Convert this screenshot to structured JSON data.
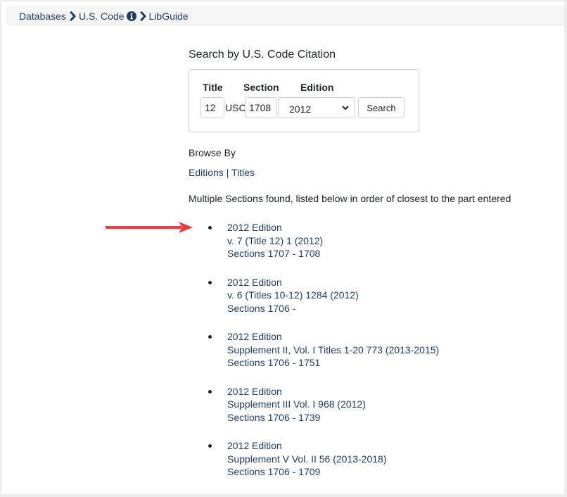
{
  "breadcrumb": {
    "items": [
      {
        "label": "Databases"
      },
      {
        "label": "U.S. Code"
      },
      {
        "label": "LibGuide"
      }
    ],
    "separator_icon": "chevron-right-icon",
    "info_icon": "info-circle-icon"
  },
  "search": {
    "heading": "Search by U.S. Code Citation",
    "title_label": "Title",
    "section_label": "Section",
    "edition_label": "Edition",
    "title_value": "12",
    "usc_label": "USC",
    "section_value": "1708",
    "edition_selected": "2012",
    "search_button": "Search"
  },
  "browse": {
    "heading": "Browse By",
    "links": [
      {
        "label": "Editions"
      },
      {
        "label": "Titles"
      }
    ],
    "divider": "|"
  },
  "results": {
    "heading": "Multiple Sections found, listed below in order of closest to the part entered",
    "items": [
      {
        "edition": "2012 Edition",
        "volume": "v. 7 (Title 12) 1 (2012)",
        "sections": "Sections 1707 - 1708"
      },
      {
        "edition": "2012 Edition",
        "volume": "v. 6 (Titles 10-12) 1284 (2012)",
        "sections": "Sections 1706 -"
      },
      {
        "edition": "2012 Edition",
        "volume": "Supplement II, Vol. I Titles 1-20 773 (2013-2015)",
        "sections": "Sections 1706 - 1751"
      },
      {
        "edition": "2012 Edition",
        "volume": "Supplement III Vol. I 968 (2012)",
        "sections": "Sections 1706 - 1739"
      },
      {
        "edition": "2012 Edition",
        "volume": "Supplement V Vol. II 56 (2013-2018)",
        "sections": "Sections 1706 - 1709"
      }
    ]
  },
  "annotation": {
    "arrow_icon": "red-arrow-right-icon",
    "arrow_color": "#ee3a3a"
  },
  "colors": {
    "link": "#1f3b5f",
    "text": "#212529",
    "breadcrumb_bg": "#f6f6f6",
    "frame": "#ececec"
  }
}
